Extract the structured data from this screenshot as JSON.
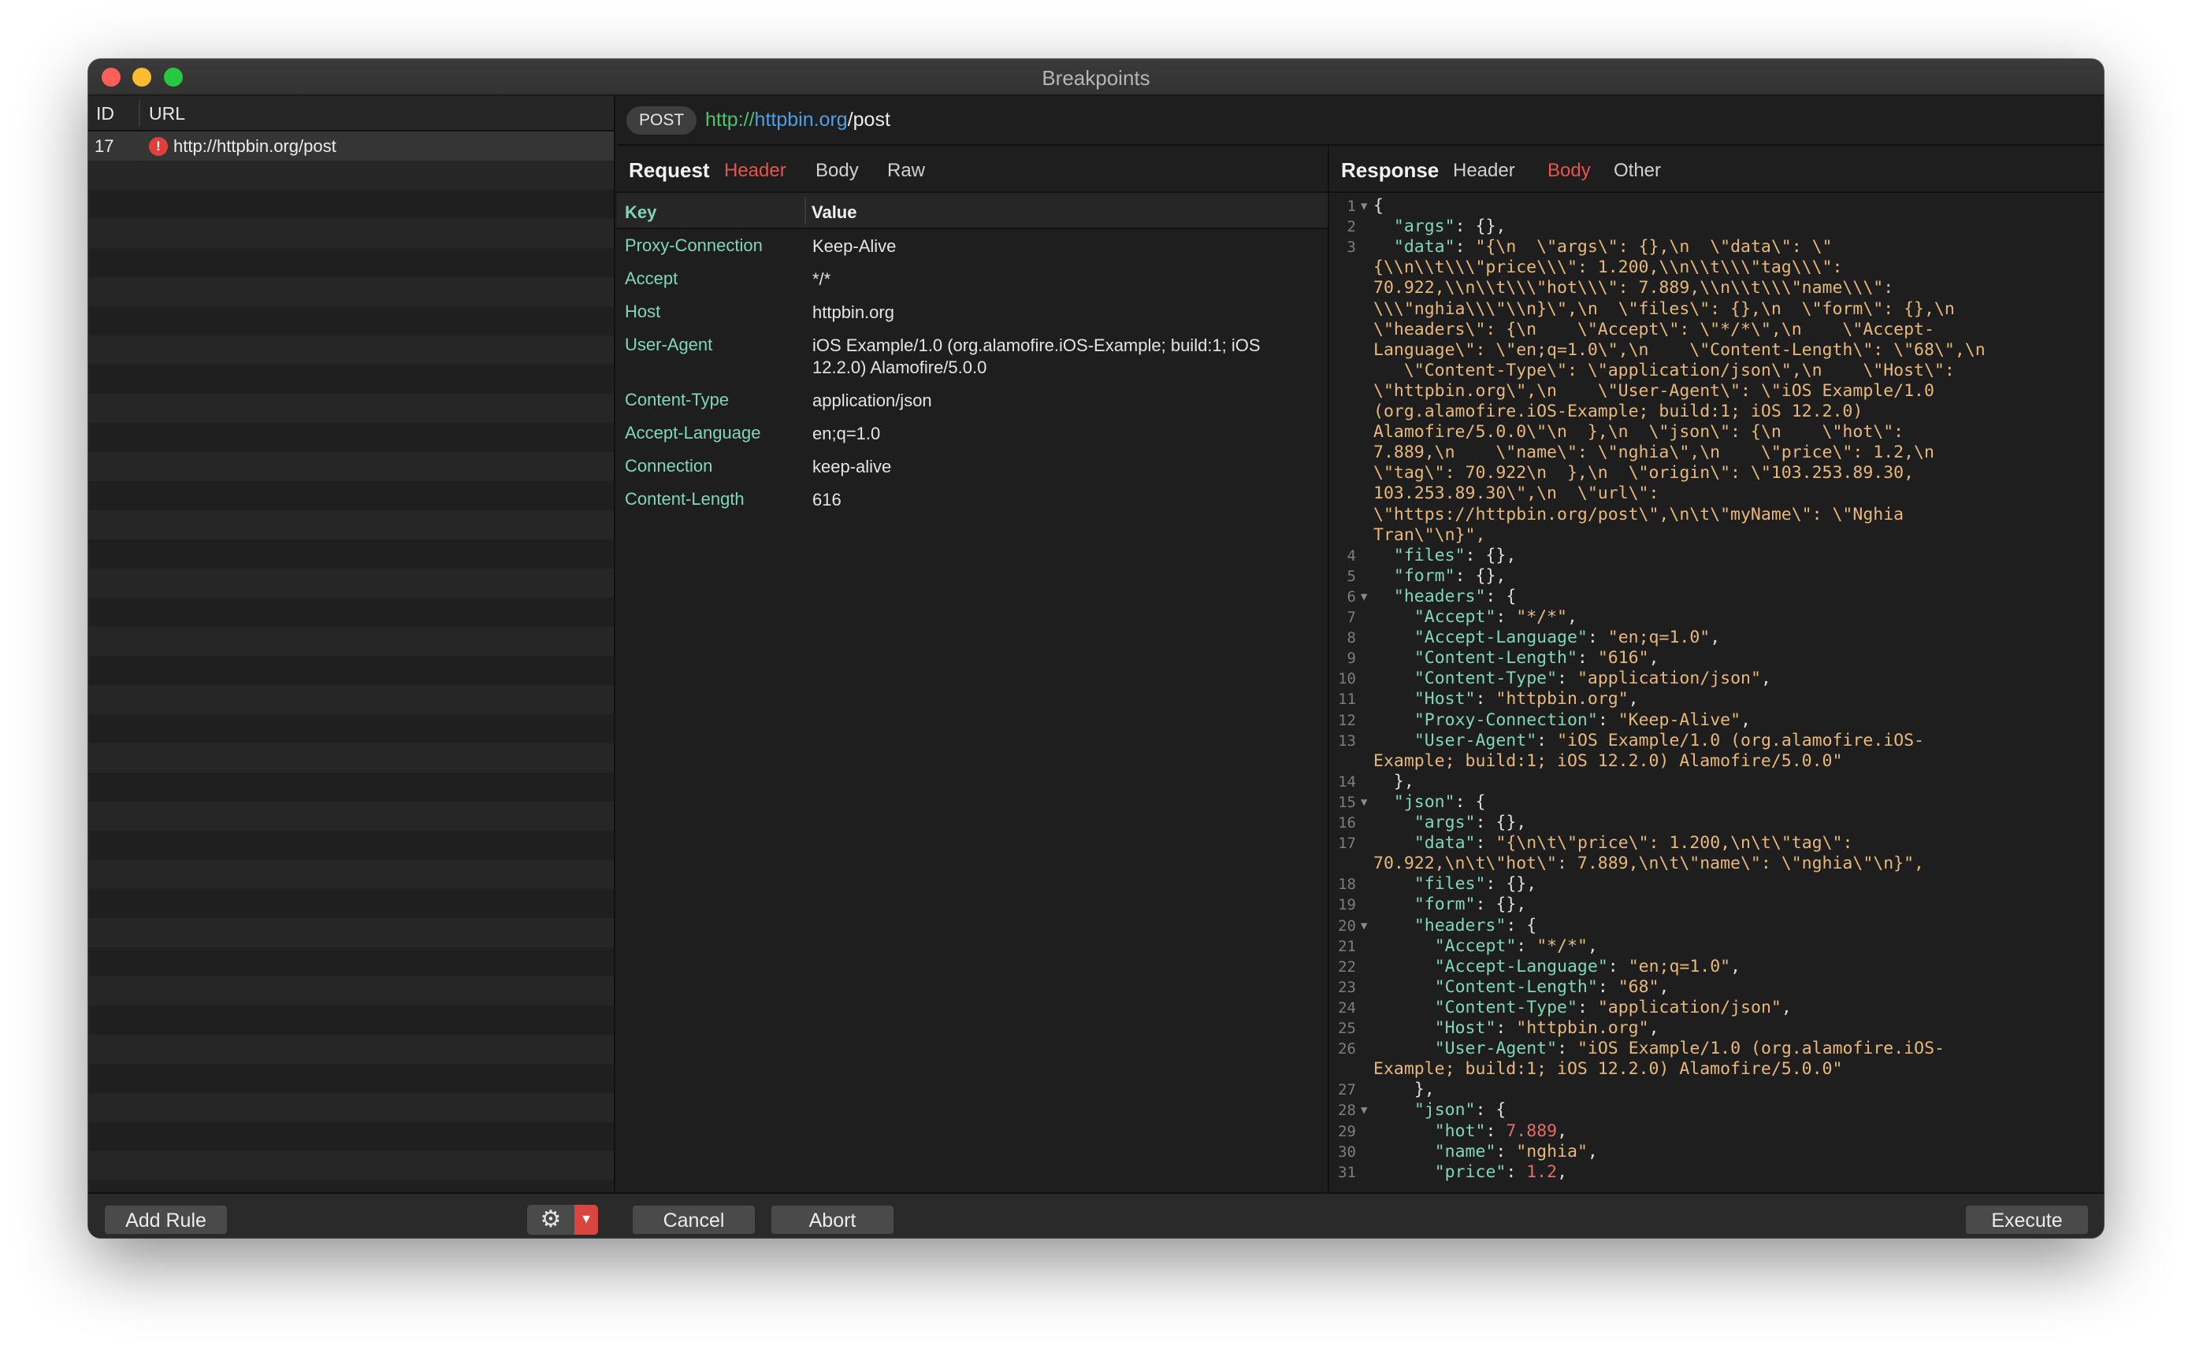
{
  "window": {
    "title": "Breakpoints"
  },
  "rules_table": {
    "col_id": "ID",
    "col_url": "URL",
    "rows": [
      {
        "id": "17",
        "url": "http://httpbin.org/post",
        "icon": "alert-icon"
      }
    ]
  },
  "request_bar": {
    "method": "POST",
    "url_scheme": "http://",
    "url_host": "httpbin.org",
    "url_path": "/post"
  },
  "request": {
    "label": "Request",
    "tabs": [
      "Header",
      "Body",
      "Raw"
    ],
    "active_tab": "Header",
    "key_header": "Key",
    "value_header": "Value",
    "headers": [
      {
        "key": "Proxy-Connection",
        "value": "Keep-Alive"
      },
      {
        "key": "Accept",
        "value": "*/*"
      },
      {
        "key": "Host",
        "value": "httpbin.org"
      },
      {
        "key": "User-Agent",
        "value": "iOS Example/1.0 (org.alamofire.iOS-Example; build:1; iOS 12.2.0) Alamofire/5.0.0"
      },
      {
        "key": "Content-Type",
        "value": "application/json"
      },
      {
        "key": "Accept-Language",
        "value": "en;q=1.0"
      },
      {
        "key": "Connection",
        "value": "keep-alive"
      },
      {
        "key": "Content-Length",
        "value": "616"
      }
    ]
  },
  "response": {
    "label": "Response",
    "tabs": [
      "Header",
      "Body",
      "Other"
    ],
    "active_tab": "Body"
  },
  "buttons": {
    "add_rule": "Add Rule",
    "cancel": "Cancel",
    "abort": "Abort",
    "execute": "Execute",
    "settings_icon": "gear-icon",
    "settings_dropdown_icon": "chevron-down-icon"
  },
  "colors": {
    "accent_red": "#e8534b",
    "url_host_blue": "#4a9fe8",
    "url_scheme_green": "#4cc46e",
    "json_key": "#7fd7b6",
    "json_string": "#e8b87a",
    "json_number": "#e86b65"
  },
  "code_lines": [
    {
      "n": "1",
      "fold": true,
      "text": "{"
    },
    {
      "n": "2",
      "text": "  \"args\": {},"
    },
    {
      "n": "3",
      "text": "  \"data\": \"{\\n  \\\"args\\\": {},\\n  \\\"data\\\": \\\""
    },
    {
      "n": "",
      "text": "{\\\\n\\\\t\\\\\\\"price\\\\\\\": 1.200,\\\\n\\\\t\\\\\\\"tag\\\\\\\":"
    },
    {
      "n": "",
      "text": "70.922,\\\\n\\\\t\\\\\\\"hot\\\\\\\": 7.889,\\\\n\\\\t\\\\\\\"name\\\\\\\":"
    },
    {
      "n": "",
      "text": "\\\\\\\"nghia\\\\\\\"\\\\n}\\\",\\n  \\\"files\\\": {},\\n  \\\"form\\\": {},\\n"
    },
    {
      "n": "",
      "text": "\\\"headers\\\": {\\n    \\\"Accept\\\": \\\"*/*\\\",\\n    \\\"Accept-"
    },
    {
      "n": "",
      "text": "Language\\\": \\\"en;q=1.0\\\",\\n    \\\"Content-Length\\\": \\\"68\\\",\\n"
    },
    {
      "n": "",
      "text": "   \\\"Content-Type\\\": \\\"application/json\\\",\\n    \\\"Host\\\":"
    },
    {
      "n": "",
      "text": "\\\"httpbin.org\\\",\\n    \\\"User-Agent\\\": \\\"iOS Example/1.0"
    },
    {
      "n": "",
      "text": "(org.alamofire.iOS-Example; build:1; iOS 12.2.0)"
    },
    {
      "n": "",
      "text": "Alamofire/5.0.0\\\"\\n  },\\n  \\\"json\\\": {\\n    \\\"hot\\\":"
    },
    {
      "n": "",
      "text": "7.889,\\n    \\\"name\\\": \\\"nghia\\\",\\n    \\\"price\\\": 1.2,\\n"
    },
    {
      "n": "",
      "text": "\\\"tag\\\": 70.922\\n  },\\n  \\\"origin\\\": \\\"103.253.89.30,"
    },
    {
      "n": "",
      "text": "103.253.89.30\\\",\\n  \\\"url\\\":"
    },
    {
      "n": "",
      "text": "\\\"https://httpbin.org/post\\\",\\n\\t\\\"myName\\\": \\\"Nghia"
    },
    {
      "n": "",
      "text": "Tran\\\"\\n}\","
    },
    {
      "n": "4",
      "text": "  \"files\": {},"
    },
    {
      "n": "5",
      "text": "  \"form\": {},"
    },
    {
      "n": "6",
      "fold": true,
      "text": "  \"headers\": {"
    },
    {
      "n": "7",
      "text": "    \"Accept\": \"*/*\","
    },
    {
      "n": "8",
      "text": "    \"Accept-Language\": \"en;q=1.0\","
    },
    {
      "n": "9",
      "text": "    \"Content-Length\": \"616\","
    },
    {
      "n": "10",
      "text": "    \"Content-Type\": \"application/json\","
    },
    {
      "n": "11",
      "text": "    \"Host\": \"httpbin.org\","
    },
    {
      "n": "12",
      "text": "    \"Proxy-Connection\": \"Keep-Alive\","
    },
    {
      "n": "13",
      "text": "    \"User-Agent\": \"iOS Example/1.0 (org.alamofire.iOS-"
    },
    {
      "n": "",
      "text": "Example; build:1; iOS 12.2.0) Alamofire/5.0.0\""
    },
    {
      "n": "14",
      "text": "  },"
    },
    {
      "n": "15",
      "fold": true,
      "text": "  \"json\": {"
    },
    {
      "n": "16",
      "text": "    \"args\": {},"
    },
    {
      "n": "17",
      "text": "    \"data\": \"{\\n\\t\\\"price\\\": 1.200,\\n\\t\\\"tag\\\":"
    },
    {
      "n": "",
      "text": "70.922,\\n\\t\\\"hot\\\": 7.889,\\n\\t\\\"name\\\": \\\"nghia\\\"\\n}\","
    },
    {
      "n": "18",
      "text": "    \"files\": {},"
    },
    {
      "n": "19",
      "text": "    \"form\": {},"
    },
    {
      "n": "20",
      "fold": true,
      "text": "    \"headers\": {"
    },
    {
      "n": "21",
      "text": "      \"Accept\": \"*/*\","
    },
    {
      "n": "22",
      "text": "      \"Accept-Language\": \"en;q=1.0\","
    },
    {
      "n": "23",
      "text": "      \"Content-Length\": \"68\","
    },
    {
      "n": "24",
      "text": "      \"Content-Type\": \"application/json\","
    },
    {
      "n": "25",
      "text": "      \"Host\": \"httpbin.org\","
    },
    {
      "n": "26",
      "text": "      \"User-Agent\": \"iOS Example/1.0 (org.alamofire.iOS-"
    },
    {
      "n": "",
      "text": "Example; build:1; iOS 12.2.0) Alamofire/5.0.0\""
    },
    {
      "n": "27",
      "text": "    },"
    },
    {
      "n": "28",
      "fold": true,
      "text": "    \"json\": {"
    },
    {
      "n": "29",
      "text": "      \"hot\": 7.889,"
    },
    {
      "n": "30",
      "text": "      \"name\": \"nghia\","
    },
    {
      "n": "31",
      "text": "      \"price\": 1.2,"
    }
  ]
}
